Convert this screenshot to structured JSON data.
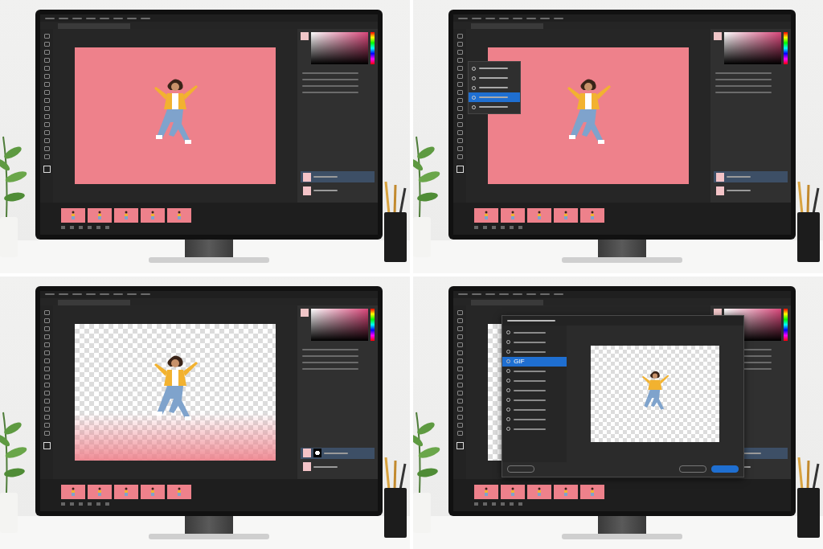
{
  "panels": [
    {
      "canvas_kind": "photo",
      "frame_count": 5,
      "layers": [
        {
          "selected": true,
          "mask": false
        },
        {
          "selected": false,
          "mask": false
        }
      ],
      "tool_menu": null,
      "export_dialog": null
    },
    {
      "canvas_kind": "photo",
      "frame_count": 5,
      "layers": [
        {
          "selected": true,
          "mask": false
        },
        {
          "selected": false,
          "mask": false
        }
      ],
      "tool_menu": {
        "items": [
          {
            "selected": false
          },
          {
            "selected": false
          },
          {
            "selected": false
          },
          {
            "selected": true
          },
          {
            "selected": false
          }
        ]
      },
      "export_dialog": null
    },
    {
      "canvas_kind": "fading",
      "frame_count": 5,
      "layers": [
        {
          "selected": true,
          "mask": true
        },
        {
          "selected": false,
          "mask": false
        }
      ],
      "tool_menu": null,
      "export_dialog": null
    },
    {
      "canvas_kind": "transparent",
      "frame_count": 5,
      "layers": [
        {
          "selected": true,
          "mask": true
        },
        {
          "selected": false,
          "mask": false
        }
      ],
      "tool_menu": null,
      "export_dialog": {
        "formats": [
          {
            "selected": false
          },
          {
            "selected": false
          },
          {
            "selected": false
          },
          {
            "label": "GIF",
            "selected": true
          },
          {
            "selected": false
          },
          {
            "selected": false
          },
          {
            "selected": false
          },
          {
            "selected": false
          },
          {
            "selected": false
          },
          {
            "selected": false
          },
          {
            "selected": false
          }
        ],
        "buttons": [
          {
            "primary": false
          },
          {
            "primary": false
          },
          {
            "primary": true
          }
        ]
      }
    }
  ]
}
